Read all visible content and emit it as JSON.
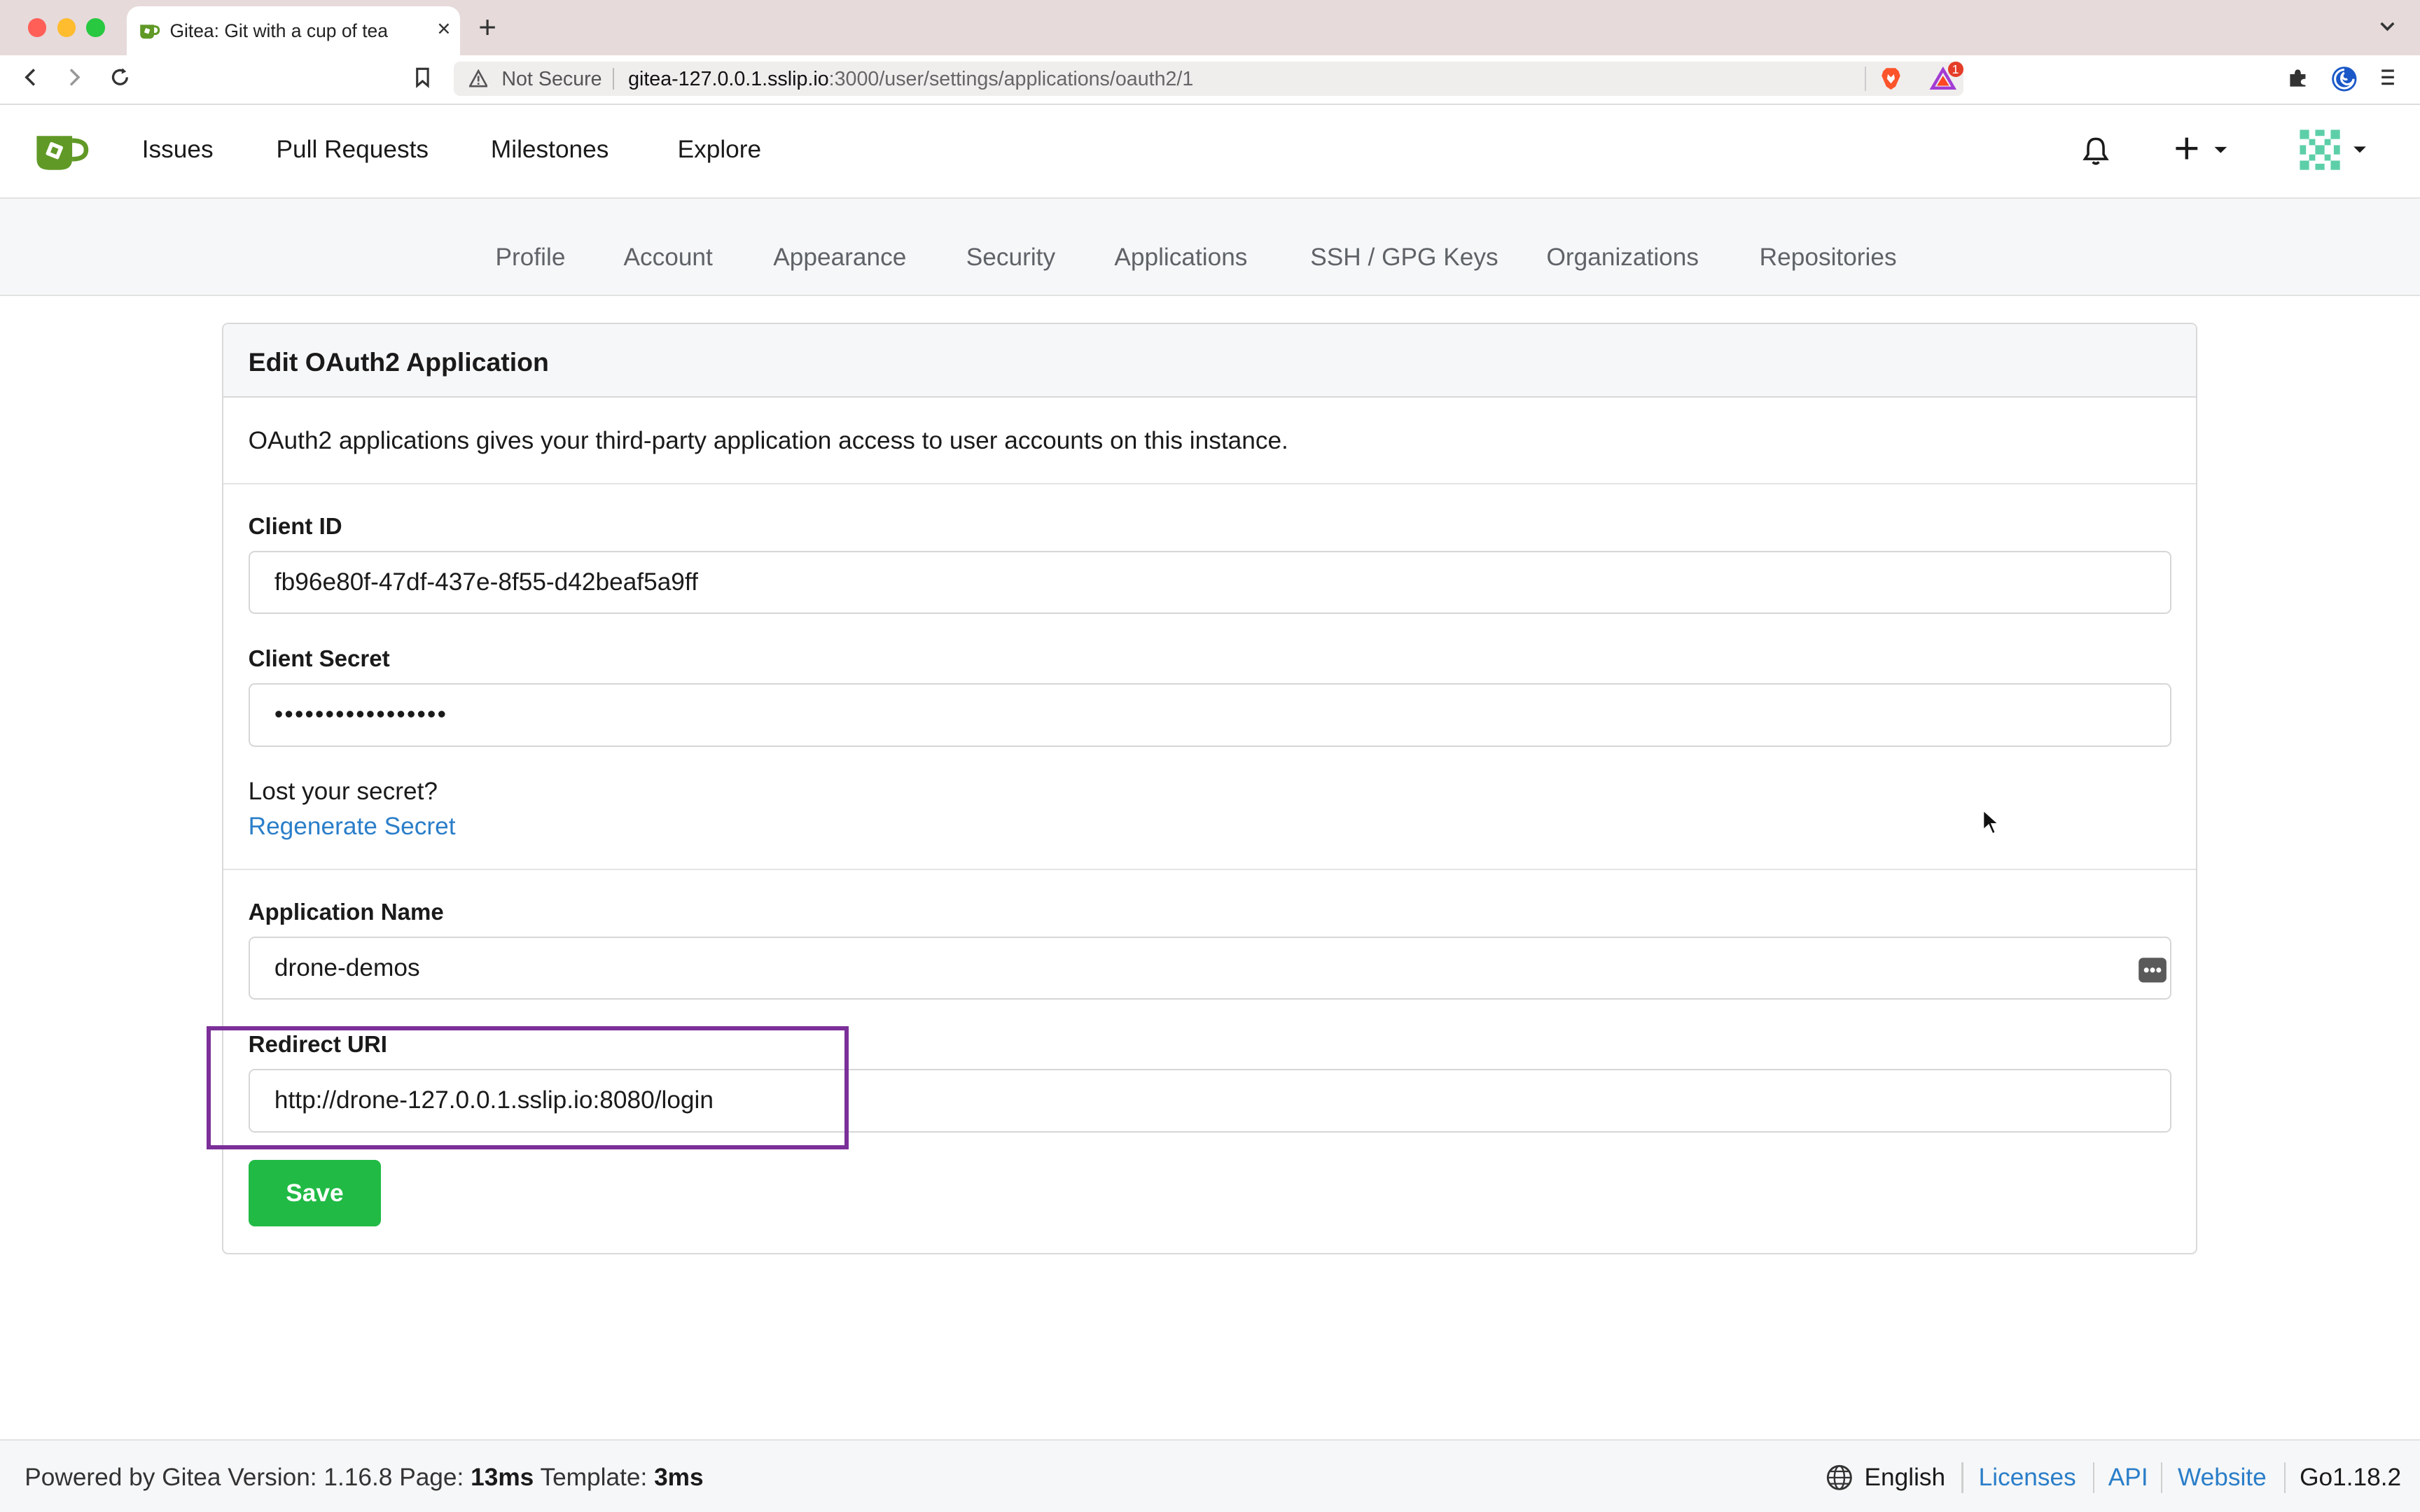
{
  "browser": {
    "tab_title": "Gitea: Git with a cup of tea",
    "tab_close": "×",
    "new_tab": "+",
    "security_label": "Not Secure",
    "url_host": "gitea-127.0.0.1.sslip.io",
    "url_path": ":3000/user/settings/applications/oauth2/1",
    "rewards_badge": "1"
  },
  "header": {
    "nav": [
      "Issues",
      "Pull Requests",
      "Milestones",
      "Explore"
    ]
  },
  "settings_menu": [
    "Profile",
    "Account",
    "Appearance",
    "Security",
    "Applications",
    "SSH / GPG Keys",
    "Organizations",
    "Repositories"
  ],
  "card": {
    "title": "Edit OAuth2 Application",
    "intro": "OAuth2 applications gives your third-party application access to user accounts on this instance.",
    "client_id_label": "Client ID",
    "client_id_value": "fb96e80f-47df-437e-8f55-d42beaf5a9ff",
    "client_secret_label": "Client Secret",
    "client_secret_value": "•••••••••••••••••",
    "lost_secret": "Lost your secret?",
    "regenerate": "Regenerate Secret",
    "app_name_label": "Application Name",
    "app_name_value": "drone-demos",
    "redirect_label": "Redirect URI",
    "redirect_value": "http://drone-127.0.0.1.sslip.io:8080/login",
    "save_label": "Save"
  },
  "footer": {
    "powered": "Powered by Gitea Version: 1.16.8 Page:",
    "page_time": "13ms",
    "template_label": "Template:",
    "template_time": "3ms",
    "language": "English",
    "licenses": "Licenses",
    "api": "API",
    "website": "Website",
    "go_version": "Go1.18.2"
  },
  "colors": {
    "accent_link": "#2a7ec9",
    "save_green": "#21ba45",
    "highlight_purple": "#7b2f98",
    "gitea_green": "#609926"
  }
}
